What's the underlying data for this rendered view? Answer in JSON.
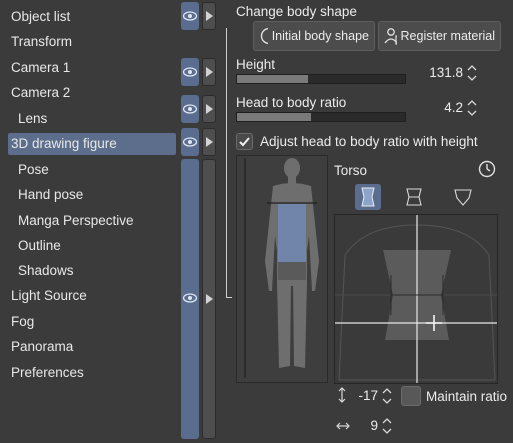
{
  "nav": {
    "items": [
      {
        "label": "Object list",
        "sub": false,
        "selected": false
      },
      {
        "label": "Transform",
        "sub": false,
        "selected": false
      },
      {
        "label": "Camera 1",
        "sub": false,
        "selected": false
      },
      {
        "label": "Camera 2",
        "sub": false,
        "selected": false
      },
      {
        "label": "Lens",
        "sub": true,
        "selected": false
      },
      {
        "label": "3D drawing figure",
        "sub": false,
        "selected": true
      },
      {
        "label": "Pose",
        "sub": true,
        "selected": false
      },
      {
        "label": "Hand pose",
        "sub": true,
        "selected": false
      },
      {
        "label": "Manga Perspective",
        "sub": true,
        "selected": false
      },
      {
        "label": "Outline",
        "sub": true,
        "selected": false
      },
      {
        "label": "Shadows",
        "sub": true,
        "selected": false
      },
      {
        "label": "Light Source",
        "sub": false,
        "selected": false
      },
      {
        "label": "Fog",
        "sub": false,
        "selected": false
      },
      {
        "label": "Panorama",
        "sub": false,
        "selected": false
      },
      {
        "label": "Preferences",
        "sub": false,
        "selected": false
      }
    ]
  },
  "panel": {
    "title": "Change body shape",
    "initial_body_shape": "Initial body shape",
    "register_material": "Register material",
    "height_label": "Height",
    "height_value": "131.8",
    "height_fraction": 0.42,
    "ratio_label": "Head to body ratio",
    "ratio_value": "4.2",
    "ratio_fraction": 0.44,
    "adjust_label": "Adjust head to body ratio with height",
    "adjust_checked": true,
    "torso_label": "Torso",
    "y_value": "-17",
    "x_value": "9",
    "maintain_ratio_label": "Maintain ratio",
    "maintain_ratio_checked": false
  },
  "icons": {
    "eye": "eye-icon",
    "arrow": "triangle-right-icon",
    "reset": "reset-clock-icon",
    "person_add": "register-person-icon",
    "vertical_arrows": "vertical-arrows-icon",
    "horizontal_arrows": "horizontal-arrows-icon"
  },
  "colors": {
    "background": "#3b3b3b",
    "selection": "#5c6e8c",
    "accent": "#5a6d8f",
    "highlight_part": "#6f85ad"
  }
}
